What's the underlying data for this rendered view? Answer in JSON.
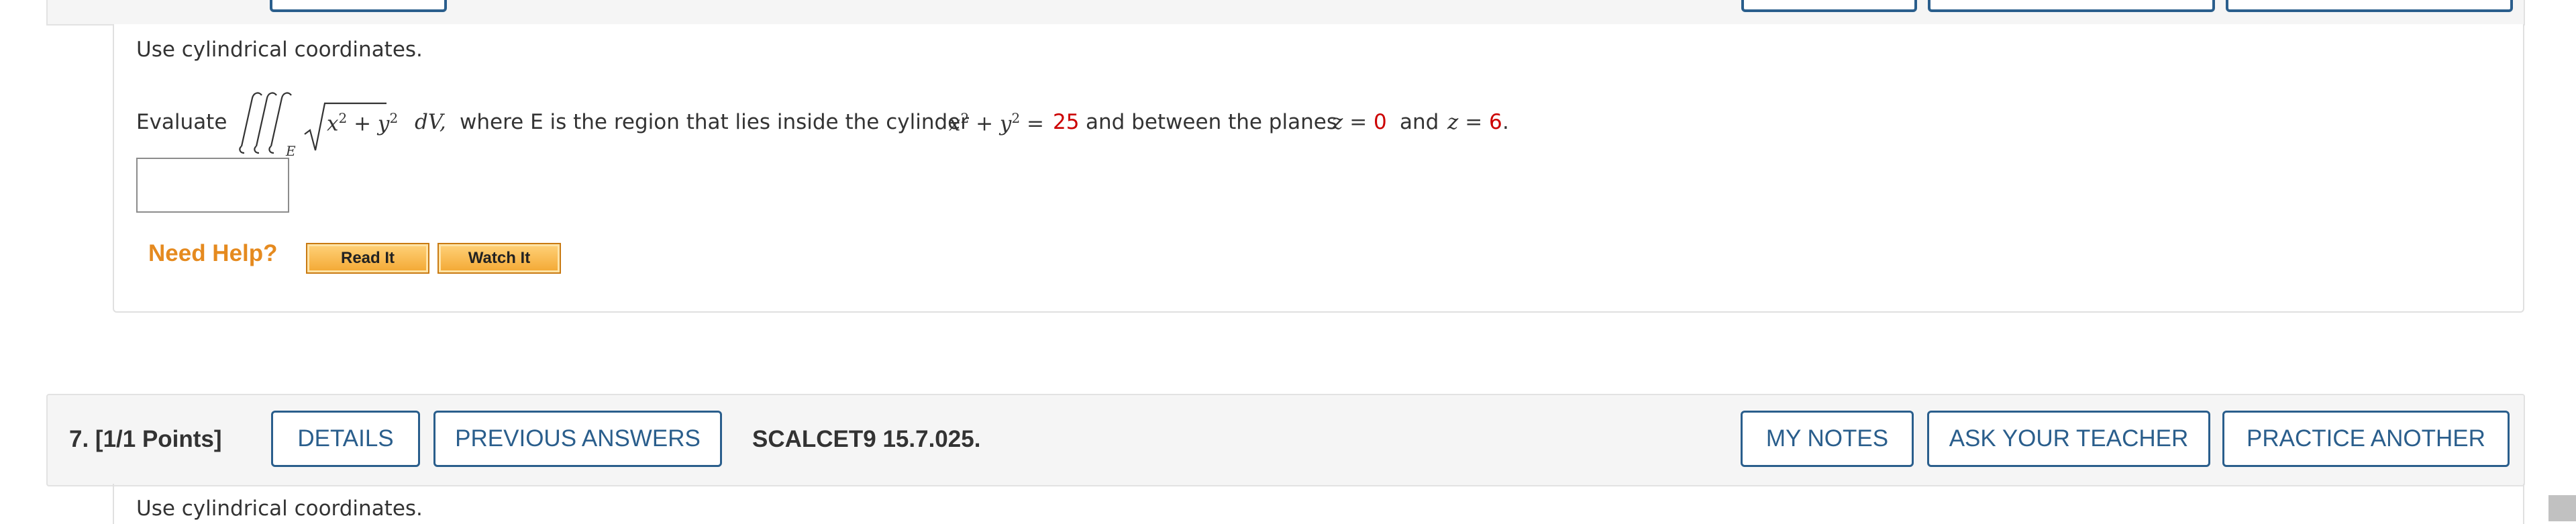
{
  "previous_question": {
    "instruction": "Use cylindrical coordinates.",
    "evaluate_label": "Evaluate",
    "integrand_var": "dV,",
    "region_subscript": "E",
    "text_middle": "where E is the region that lies inside the cylinder",
    "cylinder_rhs": "25",
    "text_planes": "and between the planes",
    "z_lower": "0",
    "and_word": "and",
    "z_upper": "6",
    "period": ".",
    "answer_value": ""
  },
  "help": {
    "label": "Need Help?",
    "read_it": "Read It",
    "watch_it": "Watch It"
  },
  "question7": {
    "number_points": "7.  [1/1 Points]",
    "details": "DETAILS",
    "previous_answers": "PREVIOUS ANSWERS",
    "code": "SCALCET9 15.7.025.",
    "my_notes": "MY NOTES",
    "ask_teacher": "ASK YOUR TEACHER",
    "practice_another": "PRACTICE ANOTHER",
    "instruction": "Use cylindrical coordinates."
  },
  "colors": {
    "accent_blue": "#2a5e8c",
    "highlight_red": "#cc0000",
    "help_orange": "#e58a1f"
  }
}
